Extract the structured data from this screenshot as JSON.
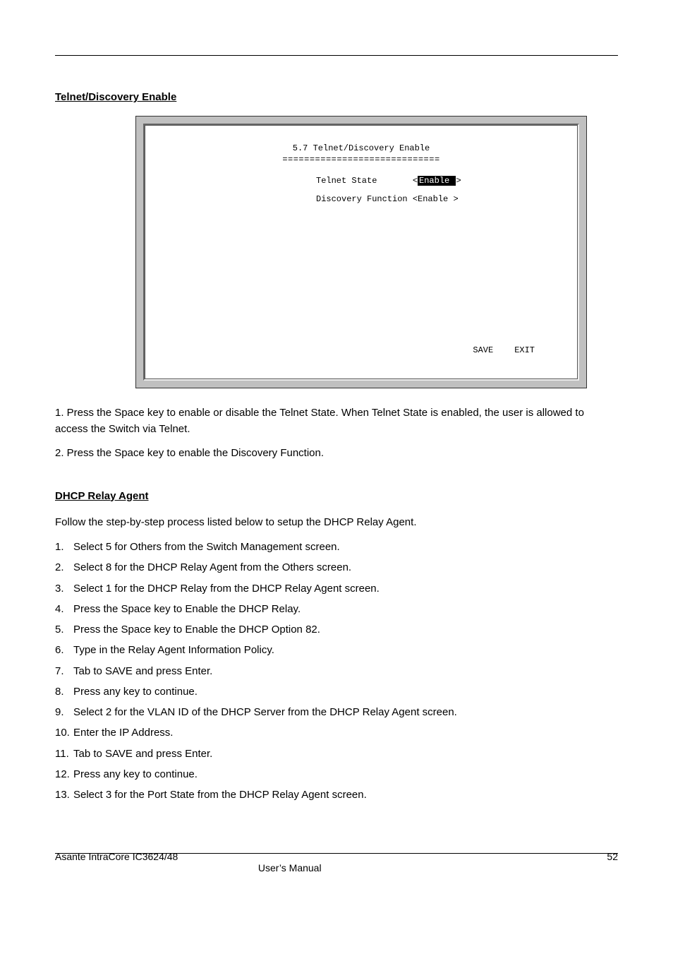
{
  "sections": {
    "first": {
      "heading": "Telnet/Discovery Enable"
    },
    "second": {
      "heading": "DHCP Relay Agent"
    }
  },
  "terminal": {
    "title": "5.7 Telnet/Discovery Enable",
    "divider": "=============================",
    "telnet_label": "Telnet State",
    "telnet_value": "Enable ",
    "discovery_label": "Discovery Function",
    "discovery_value": "Enable ",
    "save": "SAVE",
    "exit": "EXIT"
  },
  "paragraphs": {
    "p1": "1. Press the Space key to enable or disable the Telnet State. When Telnet State is enabled, the user is allowed to access the Switch via Telnet.",
    "p2": "2. Press the Space key to enable the Discovery Function.",
    "p3": "Follow the step-by-step process listed below to setup the DHCP Relay Agent.",
    "s1n": "1.",
    "s1": "Select 5 for Others from the Switch Management screen.",
    "s2n": "2.",
    "s2": "Select 8 for the DHCP Relay Agent from the Others screen.",
    "s3n": "3.",
    "s3": "Select 1 for the DHCP Relay from the DHCP Relay Agent screen.",
    "s4n": "4.",
    "s4": "Press the Space key to Enable the DHCP Relay.",
    "s5n": "5.",
    "s5": "Press the Space key to Enable the DHCP Option 82.",
    "s6n": "6.",
    "s6": "Type in the Relay Agent Information Policy.",
    "s7n": "7.",
    "s7": "Tab to SAVE and press Enter.",
    "s8n": "8.",
    "s8": "Press any key to continue.",
    "s9n": "9.",
    "s9": "Select 2 for the VLAN ID of the DHCP Server from the DHCP Relay Agent screen.",
    "s10n": "10.",
    "s10": "Enter the IP Address.",
    "s11n": "11.",
    "s11": "Tab to SAVE and press Enter.",
    "s12n": "12.",
    "s12": "Press any key to continue.",
    "s13n": "13.",
    "s13": "Select 3 for the Port State from the DHCP Relay Agent screen."
  },
  "footer": {
    "left": "Asante IntraCore IC3624/48                                                                                                                                                                                                                                       User’s Manual",
    "right": "52"
  }
}
